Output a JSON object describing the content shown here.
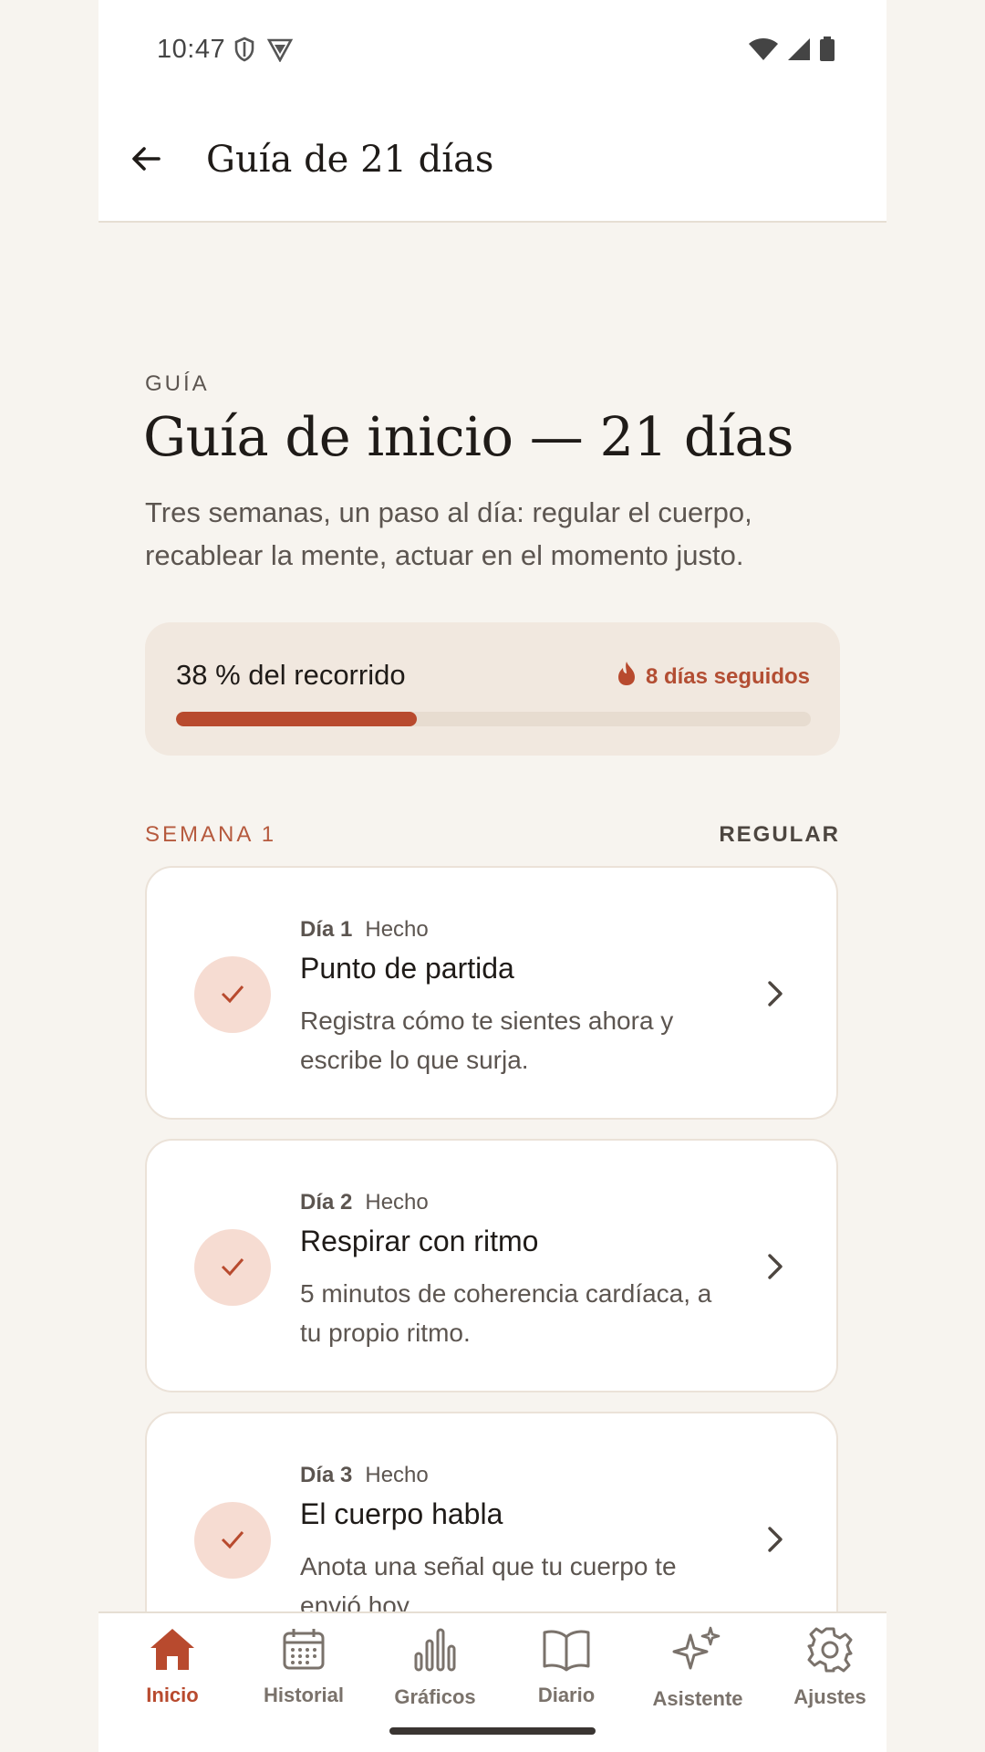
{
  "status_bar": {
    "time": "10:47"
  },
  "app_bar": {
    "title": "Guía de 21 días"
  },
  "guide": {
    "eyebrow": "GUÍA",
    "title": "Guía de inicio — 21 días",
    "subtitle": "Tres semanas, un paso al día: regular el cuerpo, recablear la mente, actuar en el momento justo."
  },
  "progress": {
    "label": "38 % del recorrido",
    "value": 0.38,
    "streak_label": "8 días seguidos"
  },
  "week": {
    "label": "SEMANA 1",
    "theme": "REGULAR"
  },
  "days": [
    {
      "num": "Día 1",
      "status": "Hecho",
      "title": "Punto de partida",
      "desc": "Registra cómo te sientes ahora y escribe lo que surja."
    },
    {
      "num": "Día 2",
      "status": "Hecho",
      "title": "Respirar con ritmo",
      "desc": "5 minutos de coherencia cardíaca, a tu propio ritmo."
    },
    {
      "num": "Día 3",
      "status": "Hecho",
      "title": "El cuerpo habla",
      "desc": "Anota una señal que tu cuerpo te envió hoy."
    }
  ],
  "nav": [
    {
      "label": "Inicio",
      "icon": "home-icon",
      "active": true
    },
    {
      "label": "Historial",
      "icon": "calendar-icon",
      "active": false
    },
    {
      "label": "Gráficos",
      "icon": "bar-chart-icon",
      "active": false
    },
    {
      "label": "Diario",
      "icon": "book-icon",
      "active": false
    },
    {
      "label": "Asistente",
      "icon": "sparkles-icon",
      "active": false
    },
    {
      "label": "Ajustes",
      "icon": "gear-icon",
      "active": false
    }
  ],
  "colors": {
    "accent": "#b84a2e",
    "background": "#f7f4ef",
    "card_tint": "#f1e8df"
  }
}
